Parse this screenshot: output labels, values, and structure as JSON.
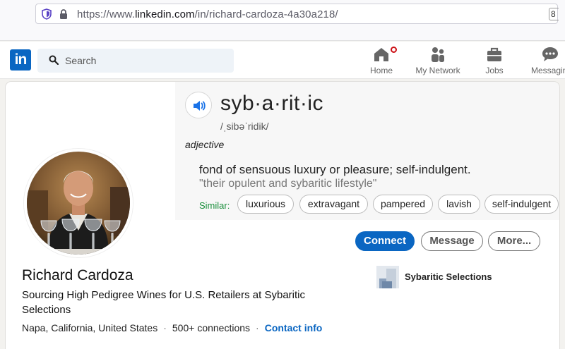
{
  "browser": {
    "url_prefix": "https://www.",
    "url_domain": "linkedin.com",
    "url_path": "/in/richard-cardoza-4a30a218/",
    "badge": "8"
  },
  "header": {
    "logo": "in",
    "search_placeholder": "Search",
    "nav": [
      {
        "label": "Home",
        "icon": "home-icon"
      },
      {
        "label": "My Network",
        "icon": "network-icon"
      },
      {
        "label": "Jobs",
        "icon": "briefcase-icon"
      },
      {
        "label": "Messaging",
        "icon": "chat-icon"
      }
    ]
  },
  "dictionary": {
    "word": "syb·a·rit·ic",
    "pronunciation": "/ˌsibəˈridik/",
    "part_of_speech": "adjective",
    "definition": "fond of sensuous luxury or pleasure; self-indulgent.",
    "example": "\"their opulent and sybaritic lifestyle\"",
    "similar_label": "Similar:",
    "similar": [
      "luxurious",
      "extravagant",
      "pampered",
      "lavish",
      "self-indulgent"
    ]
  },
  "profile": {
    "name": "Richard Cardoza",
    "headline": "Sourcing High Pedigree Wines for U.S. Retailers at Sybaritic Selections",
    "location": "Napa, California, United States",
    "connections": "500+ connections",
    "contact_info": "Contact info",
    "separator": "·",
    "company": "Sybaritic Selections"
  },
  "actions": {
    "connect": "Connect",
    "message": "Message",
    "more": "More..."
  },
  "colors": {
    "brand": "#0a66c2",
    "notification": "#cc1016",
    "similar_green": "#1a8f3c"
  }
}
